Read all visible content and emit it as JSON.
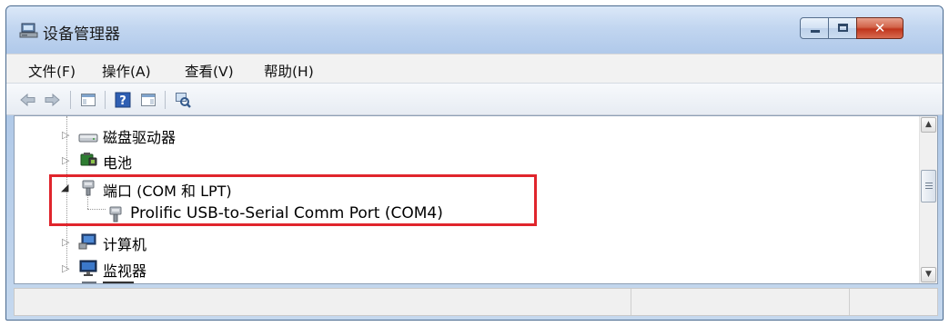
{
  "window": {
    "title": "设备管理器",
    "icon": "computer-management-icon",
    "controls": {
      "minimize": "minimize-icon",
      "maximize": "maximize-icon",
      "close": "close-icon"
    },
    "close_color": "#c7391f"
  },
  "menu": [
    {
      "label": "文件(F)"
    },
    {
      "label": "操作(A)"
    },
    {
      "label": "查看(V)"
    },
    {
      "label": "帮助(H)"
    }
  ],
  "toolbar": {
    "buttons": [
      "back-arrow-icon",
      "forward-arrow-icon",
      "show-hide-console-tree-icon",
      "help-icon",
      "show-action-pane-icon",
      "scan-hardware-changes-icon"
    ]
  },
  "tree": {
    "items": [
      {
        "label": "磁盘驱动器",
        "icon": "disk-drive-icon",
        "state": "collapsed",
        "level": 1
      },
      {
        "label": "电池",
        "icon": "battery-icon",
        "state": "collapsed",
        "level": 1
      },
      {
        "label": "端口 (COM 和 LPT)",
        "icon": "port-icon",
        "state": "expanded",
        "level": 1
      },
      {
        "label": "Prolific USB-to-Serial Comm Port (COM4)",
        "icon": "port-icon",
        "state": "leaf",
        "level": 2
      },
      {
        "label": "计算机",
        "icon": "computer-icon",
        "state": "collapsed",
        "level": 1
      },
      {
        "label": "监视器",
        "icon": "monitor-icon",
        "state": "collapsed",
        "level": 1
      }
    ],
    "highlight_color": "#e0252c"
  }
}
